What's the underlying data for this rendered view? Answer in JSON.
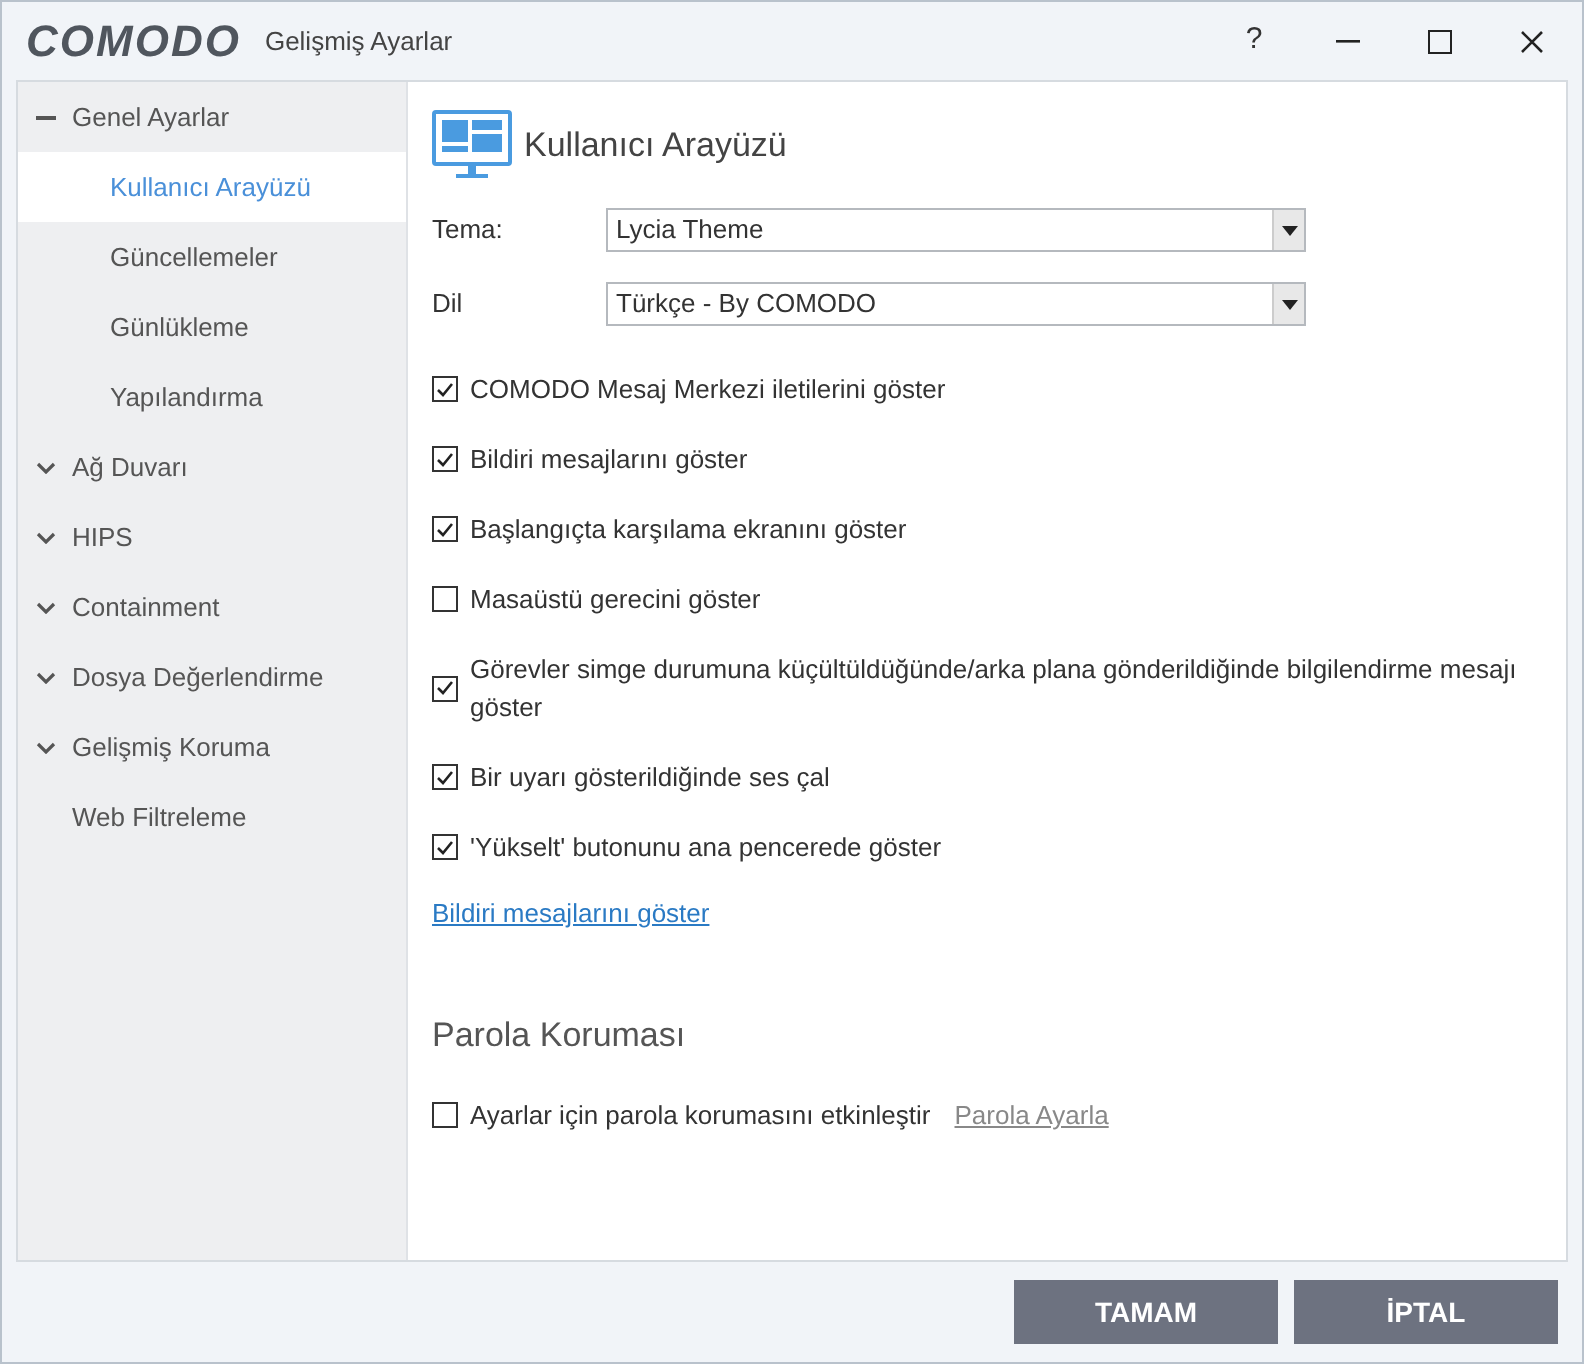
{
  "window": {
    "logo": "COMODO",
    "title": "Gelişmiş Ayarlar",
    "controls": [
      "?"
    ]
  },
  "sidebar": {
    "items": [
      {
        "label": "Genel Ayarlar",
        "expanded": true,
        "children": [
          {
            "label": "Kullanıcı Arayüzü",
            "selected": true
          },
          {
            "label": "Güncellemeler",
            "selected": false
          },
          {
            "label": "Günlükleme",
            "selected": false
          },
          {
            "label": "Yapılandırma",
            "selected": false
          }
        ]
      },
      {
        "label": "Ağ Duvarı",
        "expanded": false
      },
      {
        "label": "HIPS",
        "expanded": false
      },
      {
        "label": "Containment",
        "expanded": false
      },
      {
        "label": "Dosya Değerlendirme",
        "expanded": false
      },
      {
        "label": "Gelişmiş Koruma",
        "expanded": false
      },
      {
        "label": "Web Filtreleme"
      }
    ]
  },
  "panel": {
    "title": "Kullanıcı Arayüzü",
    "dropdowns": [
      {
        "label": "Tema:",
        "value": "Lycia Theme"
      },
      {
        "label": "Dil",
        "value": "Türkçe - By COMODO"
      }
    ],
    "options": [
      {
        "label": "COMODO Mesaj Merkezi iletilerini göster",
        "checked": true
      },
      {
        "label": "Bildiri mesajlarını göster",
        "checked": true
      },
      {
        "label": "Başlangıçta karşılama ekranını göster",
        "checked": true
      },
      {
        "label": "Masaüstü gerecini göster",
        "checked": false
      },
      {
        "label": "Görevler simge durumuna küçültüldüğünde/arka plana gönderildiğinde bilgilendirme mesajı göster",
        "checked": true
      },
      {
        "label": "Bir uyarı gösterildiğinde ses çal",
        "checked": true
      },
      {
        "label": "'Yükselt' butonunu ana pencerede göster",
        "checked": true
      }
    ],
    "link": "Bildiri mesajlarını göster",
    "password_section": {
      "title": "Parola Koruması",
      "option": {
        "label": "Ayarlar için parola korumasını etkinleştir",
        "checked": false
      },
      "link": "Parola Ayarla"
    }
  },
  "buttons": [
    "TAMAM",
    "İPTAL"
  ]
}
